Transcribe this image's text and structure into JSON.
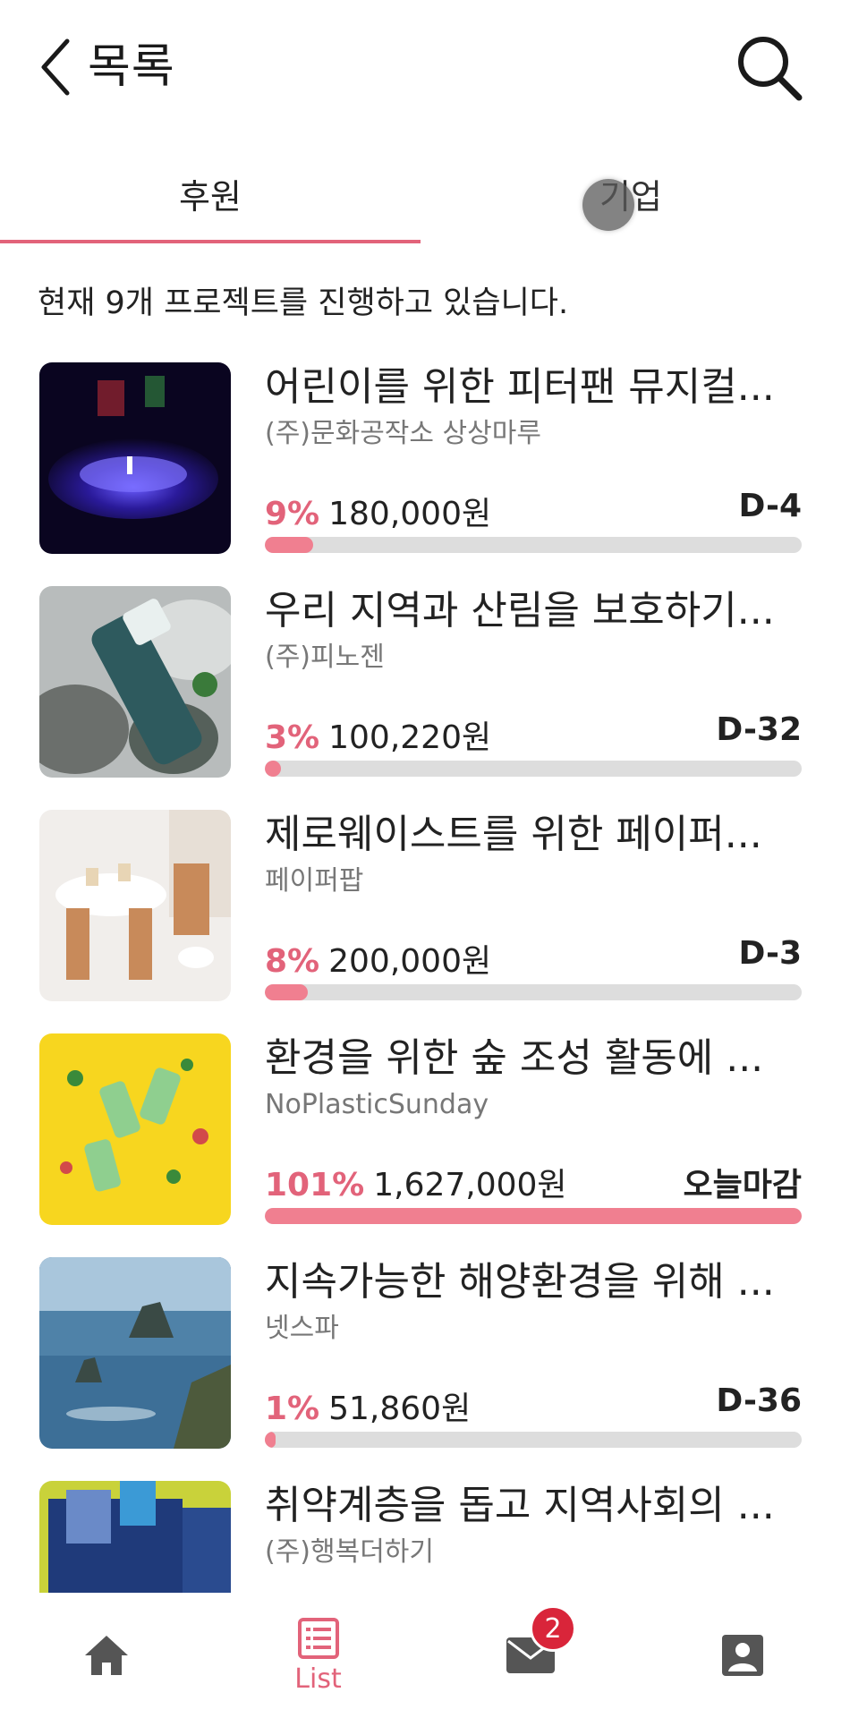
{
  "header": {
    "title": "목록"
  },
  "tabs": [
    {
      "label": "후원",
      "active": true
    },
    {
      "label": "기업",
      "active": false
    }
  ],
  "summary": "현재 9개 프로젝트를 진행하고 있습니다.",
  "projects": [
    {
      "title": "어린이를 위한 피터팬 뮤지컬...",
      "org": "(주)문화공작소 상상마루",
      "percent": "9%",
      "amount": "180,000원",
      "deadline": "D-4",
      "progress": 0.09
    },
    {
      "title": "우리 지역과 산림을 보호하기...",
      "org": "(주)피노젠",
      "percent": "3%",
      "amount": "100,220원",
      "deadline": "D-32",
      "progress": 0.03
    },
    {
      "title": "제로웨이스트를 위한 페이퍼...",
      "org": "페이퍼팝",
      "percent": "8%",
      "amount": "200,000원",
      "deadline": "D-3",
      "progress": 0.08
    },
    {
      "title": "환경을 위한 숲 조성 활동에 ...",
      "org": "NoPlasticSunday",
      "percent": "101%",
      "amount": "1,627,000원",
      "deadline": "오늘마감",
      "progress": 1.0
    },
    {
      "title": "지속가능한 해양환경을 위해 ...",
      "org": "넷스파",
      "percent": "1%",
      "amount": "51,860원",
      "deadline": "D-36",
      "progress": 0.01
    },
    {
      "title": "취약계층을 돕고 지역사회의 ...",
      "org": "(주)행복더하기",
      "percent": "",
      "amount": "",
      "deadline": "",
      "progress": 0
    }
  ],
  "bottom_nav": {
    "home_icon": "home-icon",
    "list_label": "List",
    "mail_badge": "2",
    "profile_icon": "profile-icon"
  },
  "colors": {
    "accent": "#e2637a",
    "progress_fill": "#f07f90",
    "progress_track": "#dddddd",
    "badge": "#d9253a"
  }
}
